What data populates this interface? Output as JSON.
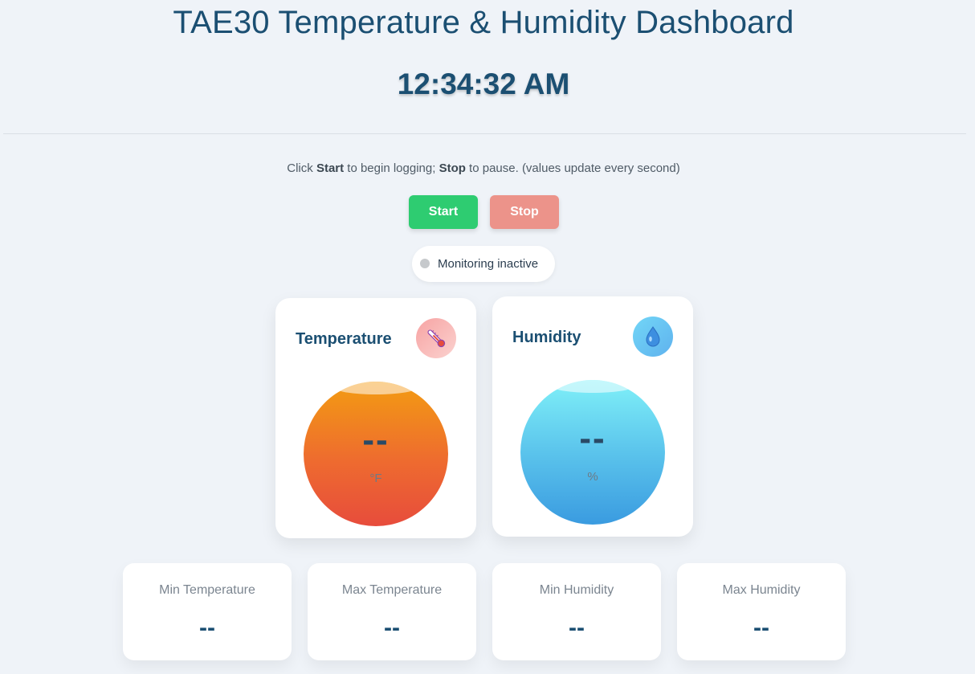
{
  "header": {
    "title": "TAE30 Temperature & Humidity Dashboard",
    "clock": "12:34:32 AM"
  },
  "instructions": {
    "prefix": "Click ",
    "start_word": "Start",
    "middle": " to begin logging; ",
    "stop_word": "Stop",
    "suffix": " to pause. (values update every second)"
  },
  "controls": {
    "start_label": "Start",
    "stop_label": "Stop",
    "start_color": "#2ecc71",
    "stop_color": "#ec938a"
  },
  "status": {
    "text": "Monitoring inactive",
    "dot_color": "#c6c9cc"
  },
  "cards": {
    "temperature": {
      "title": "Temperature",
      "icon": "thermometer-icon",
      "value": "--",
      "unit": "°F"
    },
    "humidity": {
      "title": "Humidity",
      "icon": "water-drop-icon",
      "value": "--",
      "unit": "%"
    }
  },
  "stats": [
    {
      "label": "Min Temperature",
      "value": "--"
    },
    {
      "label": "Max Temperature",
      "value": "--"
    },
    {
      "label": "Min Humidity",
      "value": "--"
    },
    {
      "label": "Max Humidity",
      "value": "--"
    }
  ],
  "colors": {
    "heading": "#1b4f72",
    "background": "#eff3f8"
  }
}
